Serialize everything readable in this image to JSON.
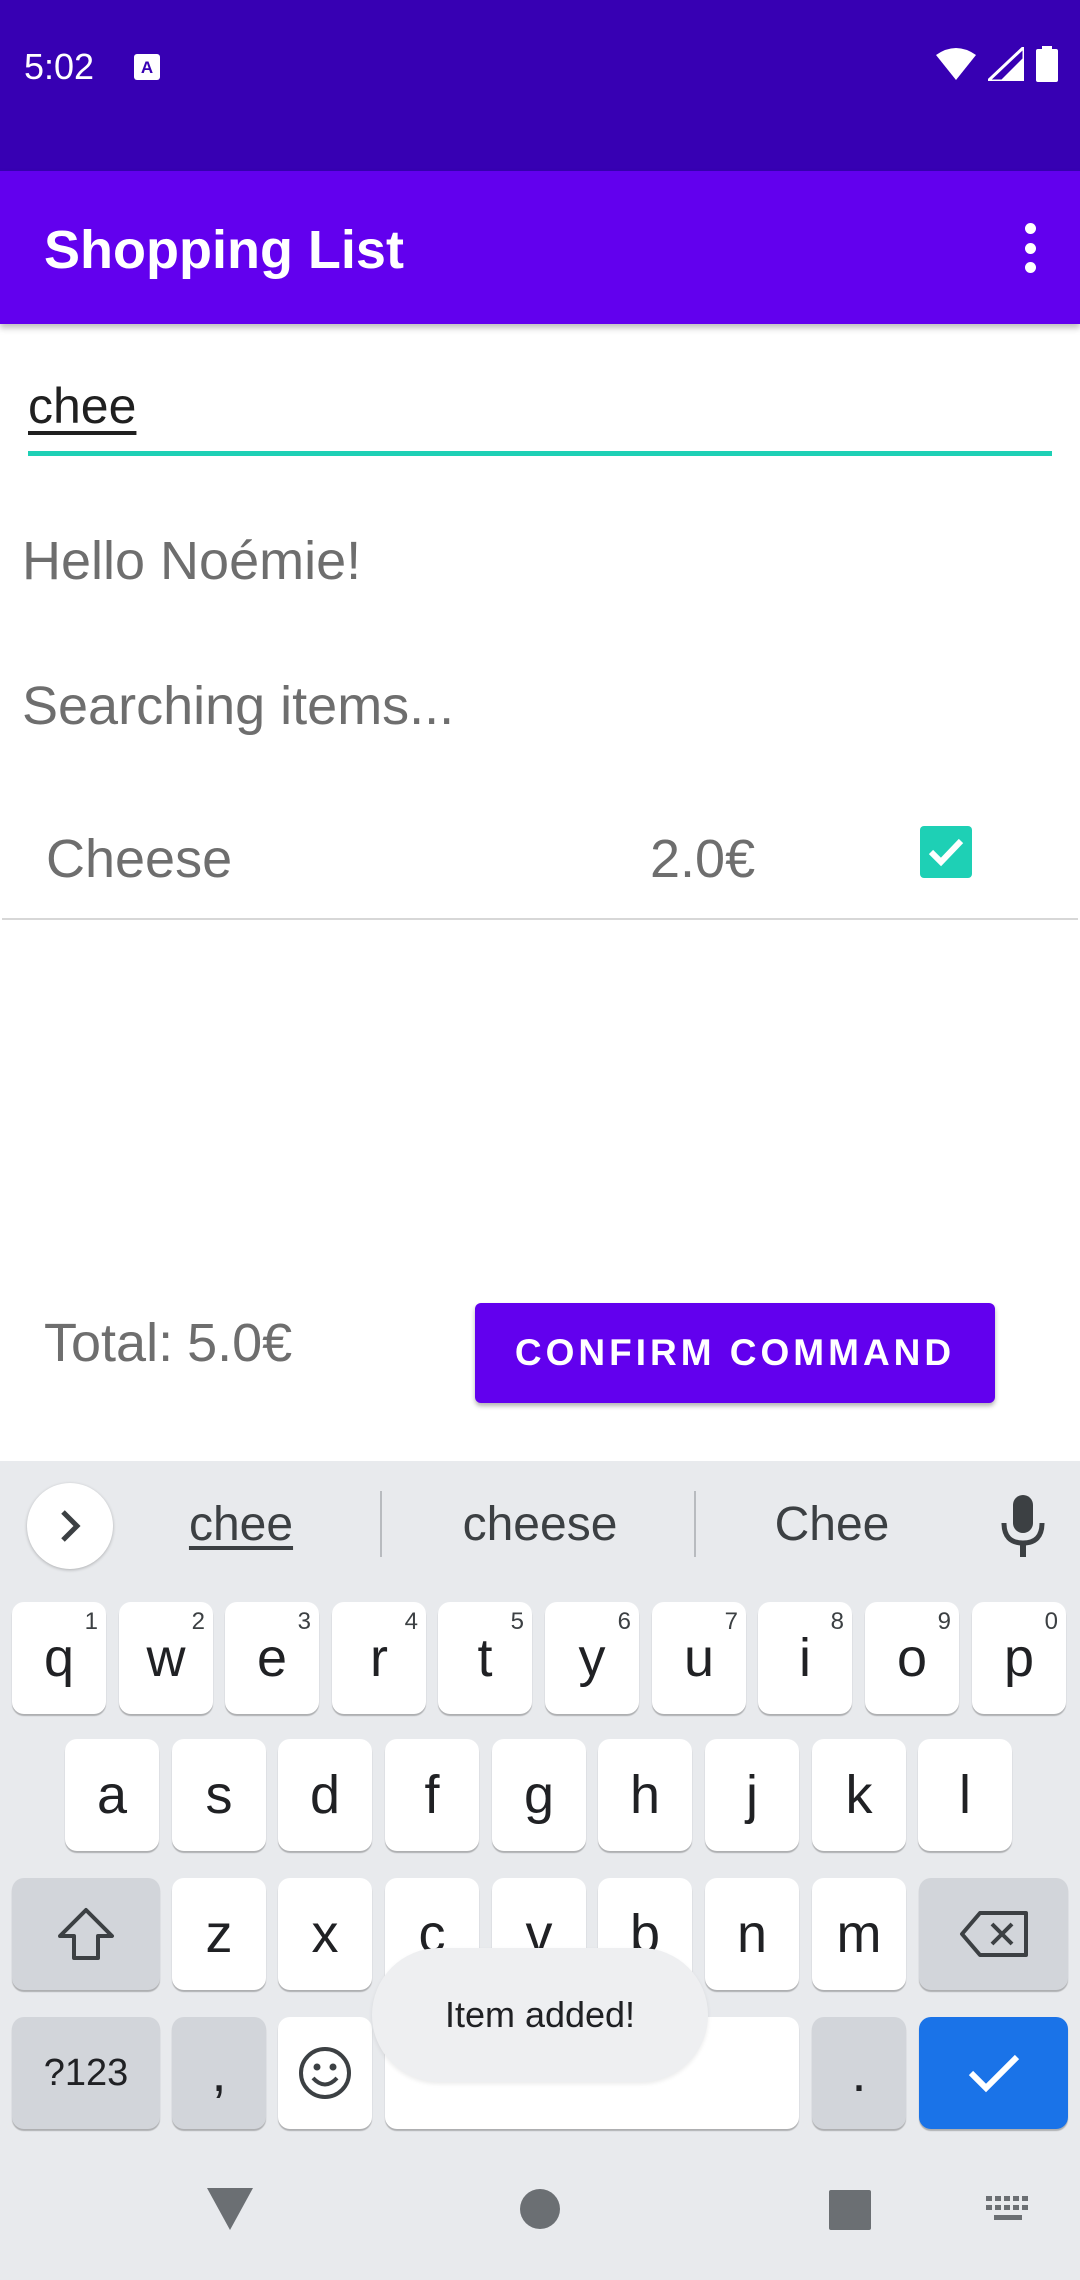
{
  "status_bar": {
    "time": "5:02",
    "background": "#3700b3"
  },
  "app_bar": {
    "title": "Shopping List",
    "background": "#6200ee"
  },
  "search": {
    "value": "chee",
    "accent": "#1ed0b5"
  },
  "greeting": "Hello Noémie!",
  "status_message": "Searching items...",
  "items": [
    {
      "name": "Cheese",
      "price": "2.0€",
      "checked": true
    }
  ],
  "footer": {
    "total_label": "Total:",
    "total_value": "5.0€",
    "confirm_label": "CONFIRM COMMAND"
  },
  "keyboard": {
    "suggestions": [
      "chee",
      "cheese",
      "Chee"
    ],
    "row1": [
      {
        "key": "q",
        "hint": "1"
      },
      {
        "key": "w",
        "hint": "2"
      },
      {
        "key": "e",
        "hint": "3"
      },
      {
        "key": "r",
        "hint": "4"
      },
      {
        "key": "t",
        "hint": "5"
      },
      {
        "key": "y",
        "hint": "6"
      },
      {
        "key": "u",
        "hint": "7"
      },
      {
        "key": "i",
        "hint": "8"
      },
      {
        "key": "o",
        "hint": "9"
      },
      {
        "key": "p",
        "hint": "0"
      }
    ],
    "row2": [
      "a",
      "s",
      "d",
      "f",
      "g",
      "h",
      "j",
      "k",
      "l"
    ],
    "row3": [
      "z",
      "x",
      "c",
      "v",
      "b",
      "n",
      "m"
    ],
    "symbols_label": "?123",
    "comma_label": ",",
    "period_label": "."
  },
  "toast": "Item added!",
  "icons": {
    "status": [
      "keyboard-a-icon",
      "wifi-icon",
      "signal-icon",
      "battery-icon"
    ],
    "app_bar": [
      "overflow-menu-icon"
    ],
    "keyboard": [
      "chevron-right-icon",
      "mic-icon",
      "shift-icon",
      "backspace-icon",
      "emoji-icon",
      "check-icon"
    ],
    "nav": [
      "back-icon",
      "home-icon",
      "recents-icon",
      "keyboard-switch-icon"
    ]
  }
}
